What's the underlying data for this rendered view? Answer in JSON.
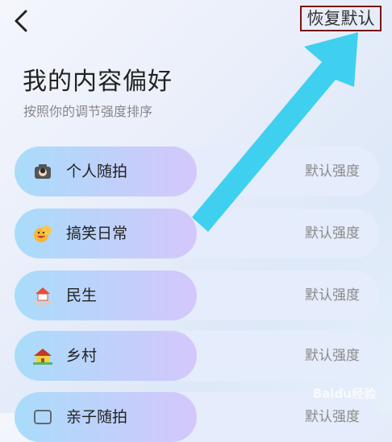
{
  "header": {
    "back_icon": "chevron-left-icon",
    "reset_label": "恢复默认"
  },
  "page": {
    "title": "我的内容偏好",
    "subtitle": "按照你的调节强度排序"
  },
  "items": [
    {
      "label": "个人随拍",
      "strength": "默认强度",
      "icon": "camera-person-icon"
    },
    {
      "label": "搞笑日常",
      "strength": "默认强度",
      "icon": "laughing-emoji-icon"
    },
    {
      "label": "民生",
      "strength": "默认强度",
      "icon": "house-hand-icon"
    },
    {
      "label": "乡村",
      "strength": "默认强度",
      "icon": "village-house-icon"
    },
    {
      "label": "亲子随拍",
      "strength": "默认强度",
      "icon": "parent-child-icon"
    }
  ],
  "annotation": {
    "arrow_color": "#3fd0f0",
    "reset_border_color": "#7a1414"
  },
  "watermark": "Baidu经验"
}
